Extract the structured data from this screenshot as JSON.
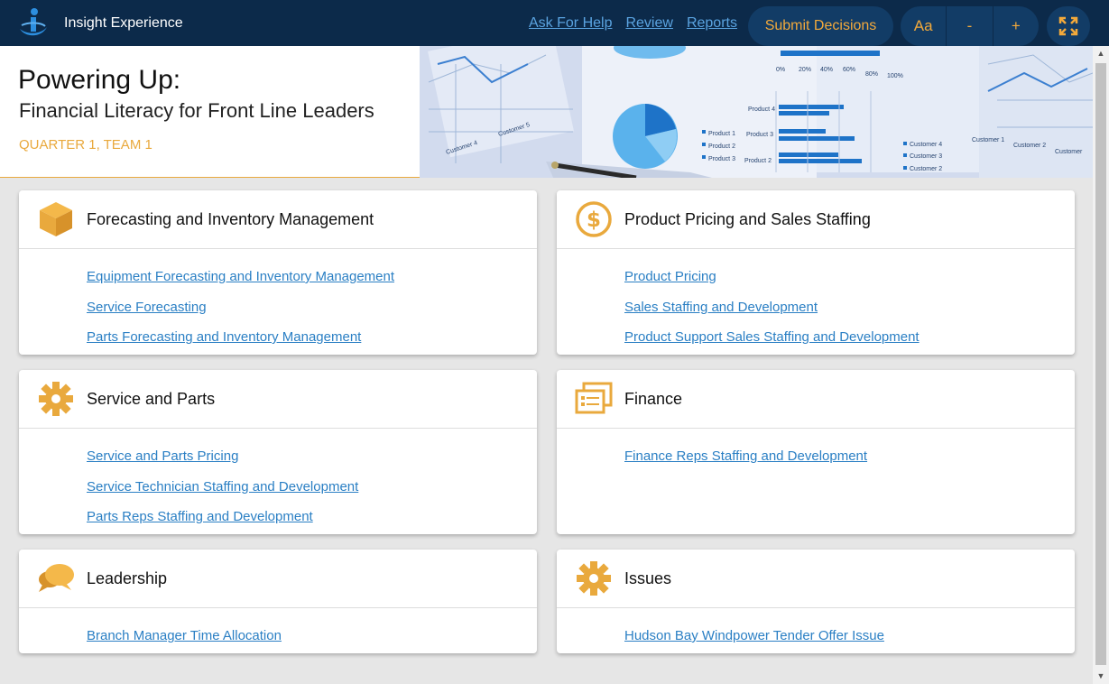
{
  "app": {
    "name": "Insight Experience",
    "logo_icon": "insight-logo-icon"
  },
  "topbar": {
    "links": [
      "Ask For Help",
      "Review",
      "Reports"
    ],
    "submit_label": "Submit Decisions",
    "font_label": "Aa",
    "decrease_label": "-",
    "increase_label": "+",
    "fullscreen_icon": "fullscreen-icon"
  },
  "header": {
    "title": "Powering Up:",
    "subtitle": "Financial Literacy for Front Line Leaders",
    "team": "QUARTER 1, TEAM 1"
  },
  "banner": {
    "axis_ticks": [
      "0%",
      "20%",
      "40%",
      "60%",
      "80%",
      "100%"
    ],
    "products": [
      "Product 4",
      "Product 3",
      "Product 2"
    ],
    "pie_legend": [
      "Product 1",
      "Product 2",
      "Product 3"
    ],
    "customers": [
      "Customer 4",
      "Customer 3",
      "Customer 2"
    ],
    "customers_left": [
      "Customer 4",
      "Customer 5"
    ],
    "customers_right": [
      "Customer 1",
      "Customer 2",
      "Customer"
    ]
  },
  "colors": {
    "accent": "#e9a93d",
    "nav_bg": "#0c2a4a",
    "link": "#2a7fc4"
  },
  "cards": [
    {
      "title": "Forecasting and Inventory Management",
      "icon": "box-icon",
      "links": [
        "Equipment Forecasting and Inventory Management",
        "Service Forecasting",
        "Parts Forecasting and Inventory Management"
      ]
    },
    {
      "title": "Product Pricing and Sales Staffing",
      "icon": "dollar-icon",
      "links": [
        "Product Pricing",
        "Sales Staffing and Development",
        "Product Support Sales Staffing and Development"
      ]
    },
    {
      "title": "Service and Parts",
      "icon": "gear-icon",
      "links": [
        "Service and Parts Pricing",
        "Service Technician Staffing and Development",
        "Parts Reps Staffing and Development"
      ]
    },
    {
      "title": "Finance",
      "icon": "document-icon",
      "links": [
        "Finance Reps Staffing and Development"
      ]
    },
    {
      "title": "Leadership",
      "icon": "speech-bubble-icon",
      "links": [
        "Branch Manager Time Allocation"
      ]
    },
    {
      "title": "Issues",
      "icon": "gear-icon",
      "links": [
        "Hudson Bay Windpower Tender Offer Issue"
      ]
    }
  ]
}
